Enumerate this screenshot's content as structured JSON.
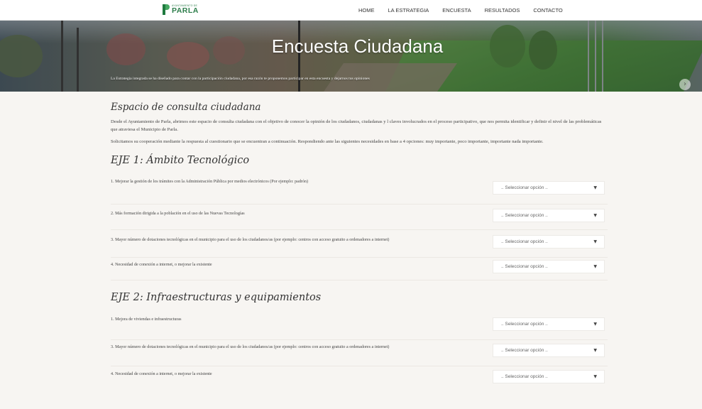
{
  "header": {
    "logo_small": "AYUNTAMIENTO DE",
    "logo_big": "PARLA",
    "nav": [
      "HOME",
      "LA ESTRATEGIA",
      "ENCUESTA",
      "RESULTADOS",
      "CONTACTO"
    ]
  },
  "hero": {
    "title": "Encuesta Ciudadana",
    "subtitle": "La Estrategia integrada se ha diseñado para contar con la participación ciudadana, por esa razón te proponemos participar en esta encuesta y dejarnos tus opiniones"
  },
  "intro": {
    "heading": "Espacio de consulta ciudadana",
    "paragraph1": "Desde el Ayuntamiento de Parla, abrimos este espacio de consulta ciudadana con el objetivo de conocer la opinión de los ciudadanos, ciudadanas y l claves involucrados en el proceso participativo, que nos permita identificar y definir el nivel de las problemáticas que atraviesa el Municipio de Parla.",
    "paragraph2": "Solicitamos su cooperación mediante la respuesta al cuestionario que se encuentran a continuación. Respondiendo ante las siguientes necesidades en base a 4 opciones: muy importante, poco importante, importante nada importante."
  },
  "select_placeholder": ".. Seleccionar opción ..",
  "eje1": {
    "title": "EJE 1: Ámbito Tecnológico",
    "questions": [
      "1. Mejorar la gestión de los trámites con la Administración Pública por medios electrónicos (Por ejemplo: padrón)",
      "2. Más formación dirigida a la población en el uso de las Nuevas Tecnologías",
      "3. Mayor número de dotaciones tecnológicas en el municipio para el uso de los ciudadanos/as (por ejemplo: centros con acceso gratuito a ordenadores a internet)",
      "4. Necesidad de conexión a internet, o mejorar la existente"
    ]
  },
  "eje2": {
    "title": "EJE 2: Infraestructuras y equipamientos",
    "questions": [
      "1. Mejora de viviendas e infraestructuras",
      "3. Mayor número de dotaciones tecnológicas en el municipio para el uso de los ciudadanos/as (por ejemplo: centros con acceso gratuito a ordenadores a internet)",
      "4. Necesidad de conexión a internet, o mejorar la existente"
    ]
  }
}
